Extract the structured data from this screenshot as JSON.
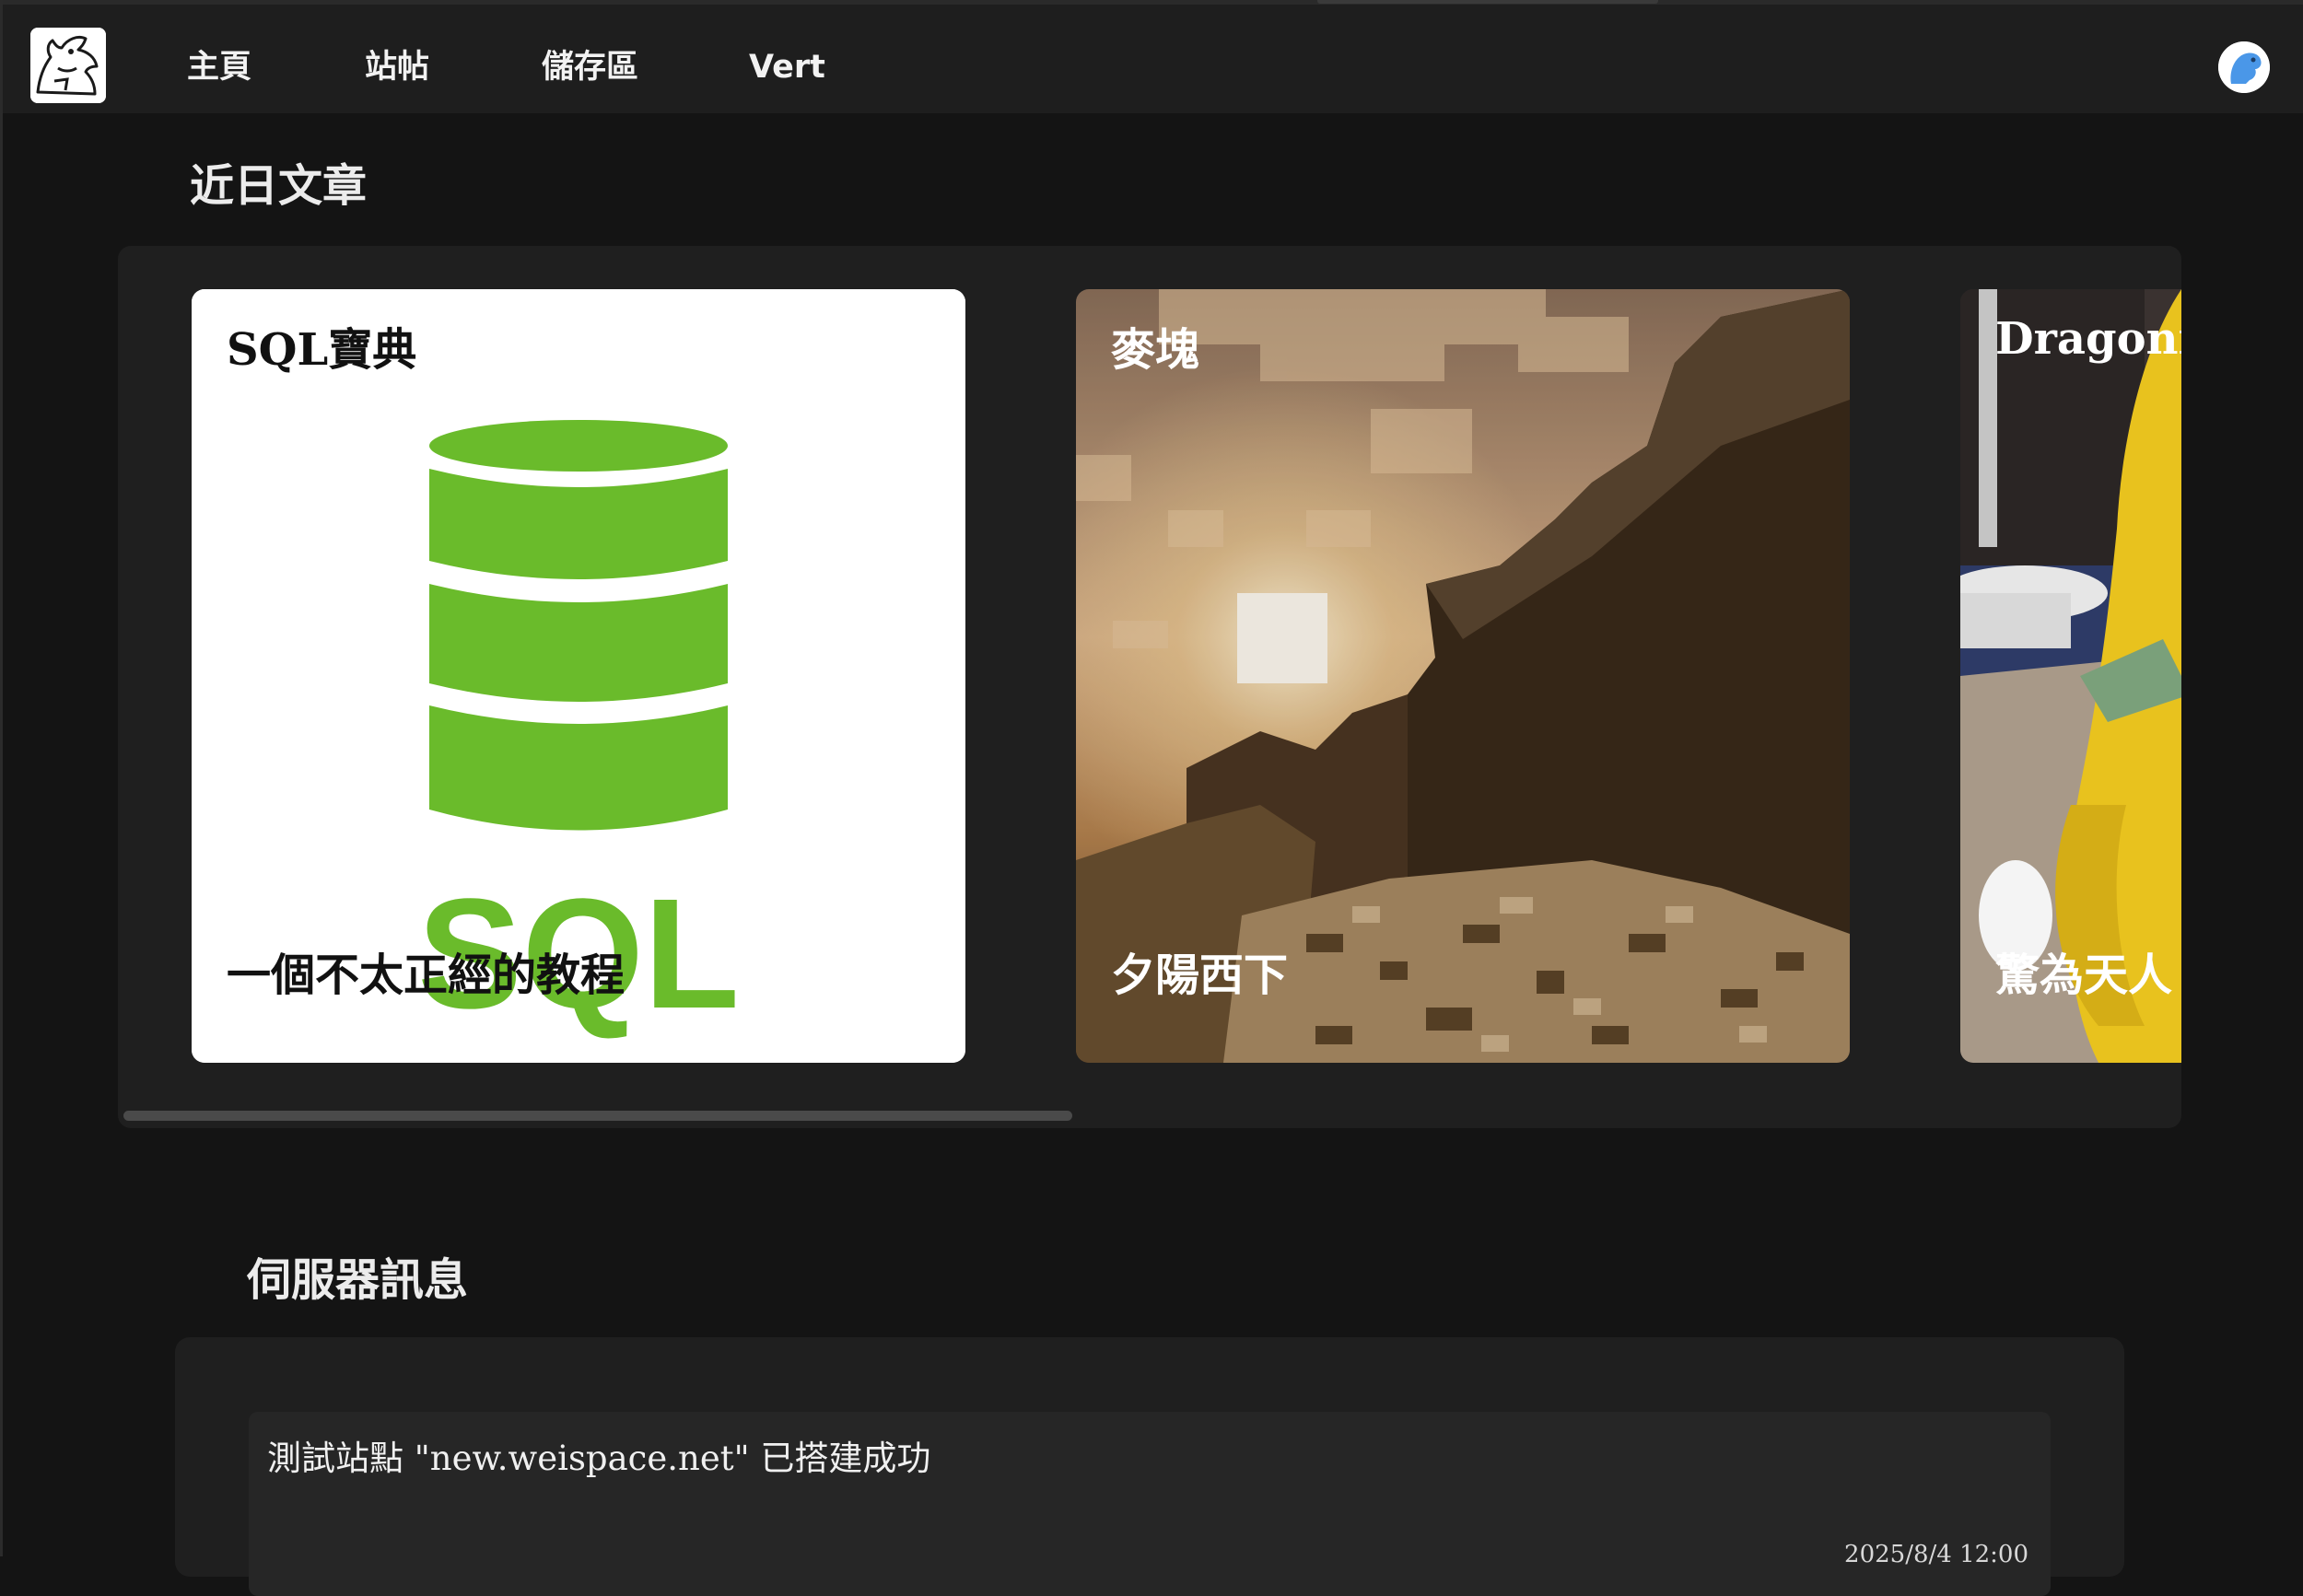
{
  "nav": {
    "items": [
      {
        "label": "主頁"
      },
      {
        "label": "站帖"
      },
      {
        "label": "儲存區"
      },
      {
        "label": "Vert"
      }
    ]
  },
  "recent": {
    "title": "近日文章",
    "cards": [
      {
        "title": "SQL寶典",
        "subtitle": "一個不太正經的教程",
        "image_text": "SQL"
      },
      {
        "title": "麥塊",
        "subtitle": "夕陽西下"
      },
      {
        "title": "Dragonite",
        "subtitle": "驚為天人"
      }
    ]
  },
  "server": {
    "title": "伺服器訊息",
    "messages": [
      {
        "text": "測試站點 \"new.weispace.net\" 已搭建成功",
        "time": "2025/8/4 12:00"
      }
    ]
  },
  "colors": {
    "background": "#141414",
    "navbar": "#1e1e1e",
    "panel": "#1f1f1f",
    "sql_green": "#6abb2b",
    "avatar_blue": "#4a97e8"
  }
}
